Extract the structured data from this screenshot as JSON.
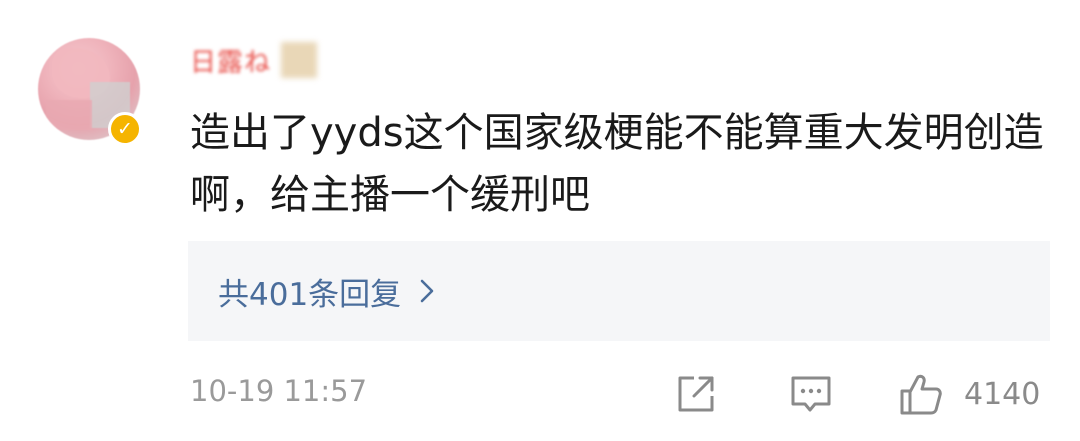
{
  "comment": {
    "username": "日露ね",
    "verified": true,
    "text": "造出了yyds这个国家级梗能不能算重大发明创造啊，给主播一个缓刑吧",
    "timestamp": "10-19 11:57",
    "replies_label": "共401条回复",
    "like_count": "4140"
  },
  "icons": {
    "share": "share-icon",
    "comment": "comment-icon",
    "like": "thumbs-up-icon",
    "chevron": "chevron-right-icon",
    "verify": "verified-badge-icon"
  },
  "colors": {
    "text": "#1a1a1a",
    "username": "#e8504a",
    "reply_link": "#4a6d9b",
    "muted": "#9a9a9a",
    "reply_bg": "#f5f6f8",
    "badge": "#f5b400"
  }
}
